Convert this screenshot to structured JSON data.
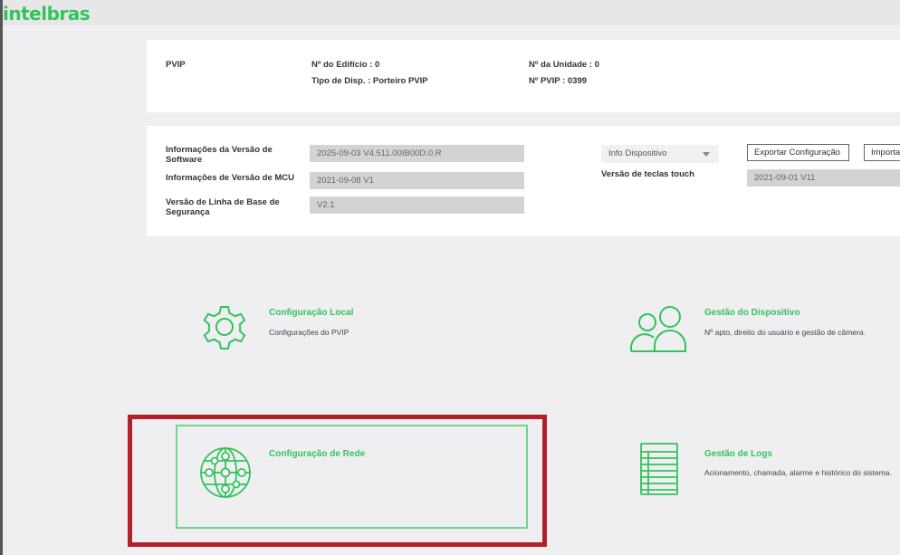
{
  "brand": {
    "logo": "intelbras",
    "accent": "#32c35c",
    "highlight": "#b22028"
  },
  "device": {
    "model": "PVIP",
    "building_label": "Nº do Edifício : 0",
    "device_type_label": "Tipo de Disp. : Porteiro PVIP",
    "unit_label": "Nº da Unidade : 0",
    "pvip_label": "Nº PVIP : 0399"
  },
  "versions": {
    "software_label": "Informações da Versão de Software",
    "software_value": "2025-09-03 V4.511.00IB00D.0.R",
    "mcu_label": "Informações de Versão de MCU",
    "mcu_value": "2021-09-08 V1",
    "baseline_label": "Versão de Linha de Base de Segurança",
    "baseline_value": "V2.1",
    "info_select": "Info Dispositivo",
    "touch_label": "Versão de teclas touch",
    "touch_value": "2021-09-01 V11",
    "export_button": "Exportar Configuração",
    "import_button": "Importar"
  },
  "tiles": [
    {
      "title": "Configuração Local",
      "desc": "Configurações do PVIP",
      "icon": "gear-icon"
    },
    {
      "title": "Gestão do Dispositivo",
      "desc": "Nº apto, direito do usuário e gestão de câmera.",
      "icon": "users-icon"
    },
    {
      "title": "Configuração de Rede",
      "desc": "",
      "icon": "network-globe-icon"
    },
    {
      "title": "Gestão de Logs",
      "desc": "Acionamento, chamada, alarme e histórico do sistema.",
      "icon": "log-document-icon"
    }
  ]
}
